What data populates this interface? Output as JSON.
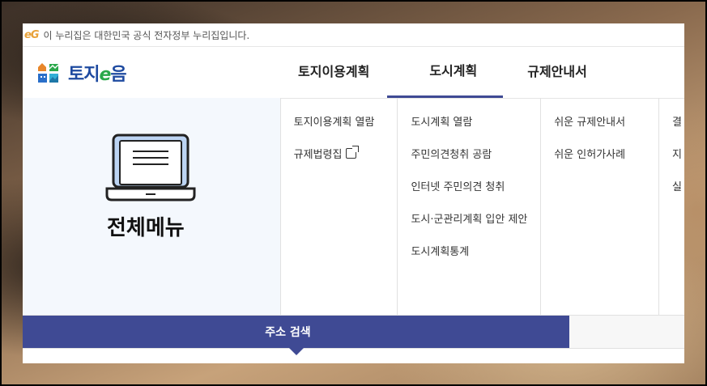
{
  "gov_notice": {
    "logo_text": "eG",
    "text": "이 누리집은 대한민국 공식 전자정부 누리집입니다."
  },
  "logo": {
    "text_main": "토지",
    "text_e": "e",
    "text_end": "음"
  },
  "nav": [
    {
      "label": "토지이용계획",
      "active": false
    },
    {
      "label": "도시계획",
      "active": true
    },
    {
      "label": "규제안내서",
      "active": false
    }
  ],
  "left_panel": {
    "title": "전체메뉴",
    "icon": "laptop-icon"
  },
  "columns": [
    {
      "links": [
        "토지이용계획 열람",
        "규제법령집"
      ]
    },
    {
      "links": [
        "도시계획 열람",
        "주민의견청취 공람",
        "인터넷 주민의견 청취",
        "도시·군관리계획 입안 제안",
        "도시계획통계"
      ]
    },
    {
      "links": [
        "쉬운 규제안내서",
        "쉬운 인허가사례"
      ]
    },
    {
      "links": [
        "결",
        "지",
        "실"
      ]
    }
  ],
  "bottom": {
    "address_search": "주소 검색"
  },
  "colors": {
    "accent": "#3f4a94",
    "left_bg": "#f4f8fd",
    "logo_blue": "#1e4aa0",
    "logo_green": "#2aa84a"
  }
}
